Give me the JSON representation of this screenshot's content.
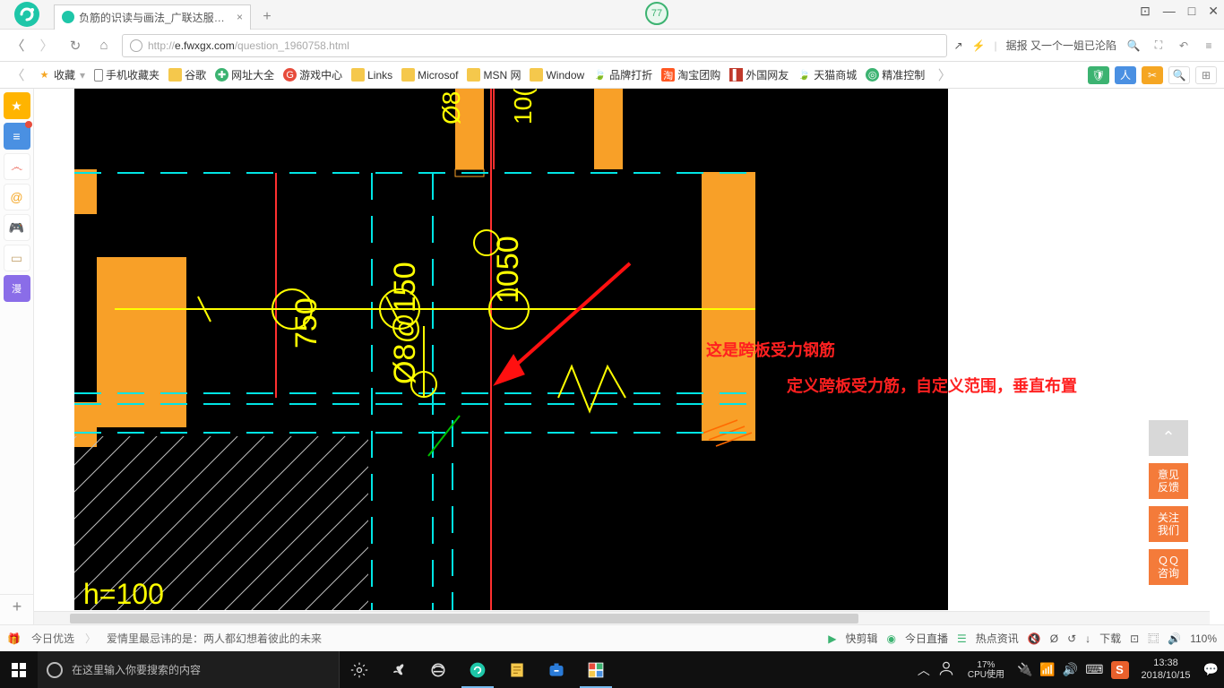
{
  "title_bar": {
    "tab_title": "负筋的识读与画法_广联达服务新…",
    "badge": "77"
  },
  "win_buttons": {
    "min": "—",
    "max": "□",
    "close": "✕",
    "pin": "⊡"
  },
  "addr": {
    "url_prefix": "http://",
    "url_host": "e.fwxgx.com",
    "url_path": "/question_1960758.html",
    "news": "据报 又一个一姐已沦陷"
  },
  "bookmarks": {
    "fav": "收藏",
    "items": [
      "手机收藏夹",
      "谷歌",
      "网址大全",
      "游戏中心",
      "Links",
      "Microsof",
      "MSN 网",
      "Window",
      "品牌打折",
      "淘宝团购",
      "外国网友",
      "天猫商城",
      "精准控制"
    ]
  },
  "sidebar": {
    "manhua": "漫"
  },
  "content": {
    "annot1": "这是跨板受力钢筋",
    "annot2": "定义跨板受力筋，自定义范围，垂直布置",
    "dim_750": "750",
    "dim_spec": "Ø8@150",
    "dim_1050": "1050",
    "dim_08": "Ø8",
    "dim_100l": "10(",
    "dim_h100": "h=100"
  },
  "float": {
    "top": "⌃",
    "feedback": "意见\n反馈",
    "follow": "关注\n我们",
    "qq": "ＱＱ\n咨询"
  },
  "status": {
    "today": "今日优选",
    "quote": "爱情里最忌讳的是：两人都幻想着彼此的未来",
    "clip": "快剪辑",
    "live": "今日直播",
    "hot": "热点资讯",
    "download": "下载",
    "zoom": "110%"
  },
  "taskbar": {
    "search_placeholder": "在这里输入你要搜索的内容",
    "cpu_pct": "17%",
    "cpu_label": "CPU使用",
    "time": "13:38",
    "date": "2018/10/15"
  }
}
